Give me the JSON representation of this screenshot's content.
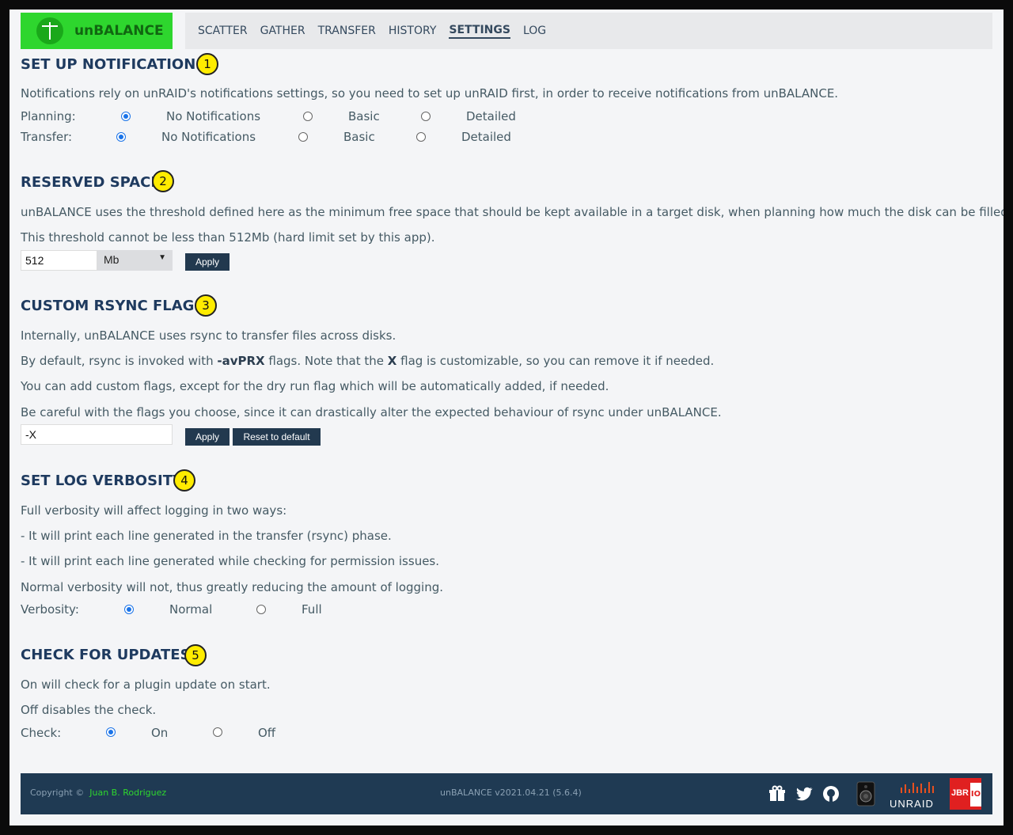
{
  "app": {
    "logo_text": "unBALANCE"
  },
  "nav": {
    "items": [
      {
        "label": "SCATTER"
      },
      {
        "label": "GATHER"
      },
      {
        "label": "TRANSFER"
      },
      {
        "label": "HISTORY"
      },
      {
        "label": "SETTINGS",
        "active": true
      },
      {
        "label": "LOG"
      }
    ]
  },
  "notifications": {
    "title": "SET UP NOTIFICATIONS",
    "badge": "1",
    "description": "Notifications rely on unRAID's notifications settings, so you need to set up unRAID first, in order to receive notifications from unBALANCE.",
    "rows": [
      {
        "label": "Planning:",
        "options": [
          "No Notifications",
          "Basic",
          "Detailed"
        ],
        "selected": "No Notifications"
      },
      {
        "label": "Transfer:",
        "options": [
          "No Notifications",
          "Basic",
          "Detailed"
        ],
        "selected": "No Notifications"
      }
    ]
  },
  "reserved": {
    "title": "RESERVED SPACE",
    "badge": "2",
    "line1": "unBALANCE uses the threshold defined here as the minimum free space that should be kept available in a target disk, when planning how much the disk can be filled.",
    "line2": "This threshold cannot be less than 512Mb (hard limit set by this app).",
    "value": "512",
    "unit": "Mb",
    "apply_label": "Apply"
  },
  "rsync": {
    "title": "CUSTOM RSYNC FLAGS",
    "badge": "3",
    "line1": "Internally, unBALANCE uses rsync to transfer files across disks.",
    "line2_a": "By default, rsync is invoked with ",
    "line2_b": "-avPRX",
    "line2_c": " flags. Note that the ",
    "line2_d": "X",
    "line2_e": " flag is customizable, so you can remove it if needed.",
    "line3": "You can add custom flags, except for the dry run flag which will be automatically added, if needed.",
    "line4": "Be careful with the flags you choose, since it can drastically alter the expected behaviour of rsync under unBALANCE.",
    "value": "-X",
    "apply_label": "Apply",
    "reset_label": "Reset to default"
  },
  "verbosity": {
    "title": "SET LOG VERBOSITY",
    "badge": "4",
    "line1": "Full verbosity will affect logging in two ways:",
    "line2": "- It will print each line generated in the transfer (rsync) phase.",
    "line3": "- It will print each line generated while checking for permission issues.",
    "line4": "Normal verbosity will not, thus greatly reducing the amount of logging.",
    "label": "Verbosity:",
    "options": [
      "Normal",
      "Full"
    ],
    "selected": "Normal"
  },
  "updates": {
    "title": "CHECK FOR UPDATES",
    "badge": "5",
    "line1": "On will check for a plugin update on start.",
    "line2": "Off disables the check.",
    "label": "Check:",
    "options": [
      "On",
      "Off"
    ],
    "selected": "On"
  },
  "footer": {
    "copyright": "Copyright ©",
    "author": "Juan B. Rodriguez",
    "version": "unBALANCE v2021.04.21 (5.6.4)",
    "unraid": "UNRAID",
    "jbrio_a": "JBR",
    "jbrio_b": "IO",
    "colors": {
      "bg": "#1f3a53",
      "link": "#2ed62e"
    }
  },
  "colors": {
    "accent": "#2ed62e",
    "heading": "#1e3a5f",
    "badge": "#ffec00",
    "button": "#22394f"
  }
}
